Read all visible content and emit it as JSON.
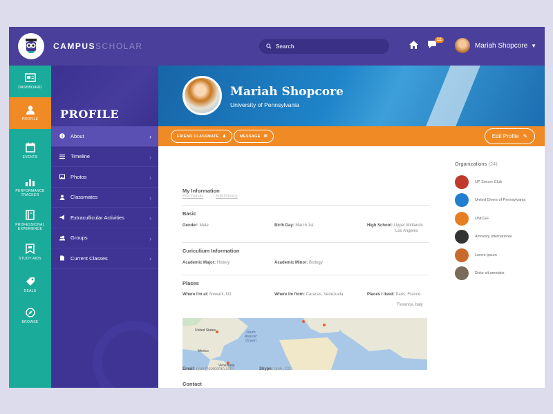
{
  "header": {
    "brand_bold": "CAMPUS",
    "brand_light": "SCHOLAR",
    "search_placeholder": "Search",
    "notification_count": "12",
    "user_name": "Mariah Shopcore"
  },
  "rail": [
    {
      "label": "DASHBOARD",
      "icon": "dashboard-icon",
      "active": false
    },
    {
      "label": "PROFILE",
      "icon": "user-icon",
      "active": true
    },
    {
      "label": "EVENTS",
      "icon": "calendar-icon",
      "active": false
    },
    {
      "label": "PERFORMANCE\nTRACKER",
      "icon": "bar-chart-icon",
      "active": false
    },
    {
      "label": "PROFESSIONAL\nEXPERIENCE",
      "icon": "book-icon",
      "active": false
    },
    {
      "label": "STUDY AIDS",
      "icon": "bookmark-icon",
      "active": false
    },
    {
      "label": "DEALS",
      "icon": "tag-icon",
      "active": false
    },
    {
      "label": "BROWSE",
      "icon": "compass-icon",
      "active": false
    }
  ],
  "subnav": {
    "title": "PROFILE",
    "items": [
      {
        "label": "About",
        "icon": "info-icon",
        "active": true
      },
      {
        "label": "Timeline",
        "icon": "list-icon",
        "active": false
      },
      {
        "label": "Photos",
        "icon": "image-icon",
        "active": false
      },
      {
        "label": "Classmates",
        "icon": "person-icon",
        "active": false
      },
      {
        "label": "Extracullicular Activities",
        "icon": "megaphone-icon",
        "active": false
      },
      {
        "label": "Groups",
        "icon": "group-icon",
        "active": false
      },
      {
        "label": "Current Classes",
        "icon": "document-icon",
        "active": false
      }
    ]
  },
  "hero": {
    "name": "Mariah Shopcore",
    "university": "University of Pennsylvania"
  },
  "actions": {
    "friend_label": "FRIEND CLASSMATE",
    "message_label": "MESSAGE",
    "edit_label": "Edit Profile"
  },
  "info": {
    "title": "My Information",
    "edit_details": "Edit Details",
    "edit_privacy": "Edit Privacy",
    "basic": {
      "title": "Basic",
      "gender_label": "Gender:",
      "gender_value": "Male",
      "birthday_label": "Birth Day:",
      "birthday_value": "March 1st",
      "highschool_label": "High School:",
      "highschool_value_1": "Upper Midlands",
      "highschool_value_2": "Los Angeles"
    },
    "curriculum": {
      "title": "Curiculium Information",
      "major_label": "Academic Major:",
      "major_value": "History",
      "minor_label": "Academic Minor:",
      "minor_value": "Biology"
    },
    "places": {
      "title": "Places",
      "where_label": "Where I'm at:",
      "where_value": "Newark, NJ",
      "from_label": "Where Im from:",
      "from_value": "Caracas, Venezuela",
      "lived_label": "Places I lived:",
      "lived_value_1": "Paris, France",
      "lived_value_2": "Florence, Italy"
    },
    "map_labels": {
      "north_atlantic": "North\nAtlantic\nOcean",
      "united_states": "United States",
      "mexico": "Mexico",
      "venezuela": "Venezuela"
    },
    "contact": {
      "title": "Contact",
      "email_label": "Email:",
      "email_value": "ryan@corcoran.com",
      "skype_label": "Skype:",
      "skype_value": "ryan_231"
    }
  },
  "organizations": {
    "title": "Organizations",
    "count": "(24)",
    "items": [
      {
        "name": "UP Soccer Club",
        "color": "#c0392b"
      },
      {
        "name": "United Divers of Pennsylvania",
        "color": "#1f7fd0"
      },
      {
        "name": "UNICEF",
        "color": "#e67e22"
      },
      {
        "name": "Amnesty International",
        "color": "#333333"
      },
      {
        "name": "Lorem ipsum",
        "color": "#c96a2b"
      },
      {
        "name": "Dolor sit ametatis",
        "color": "#7a6a5a"
      }
    ]
  },
  "colors": {
    "topbar": "#4a3f9a",
    "rail": "#1bab9b",
    "accent": "#f08a24",
    "subnav": "#3f3494"
  }
}
